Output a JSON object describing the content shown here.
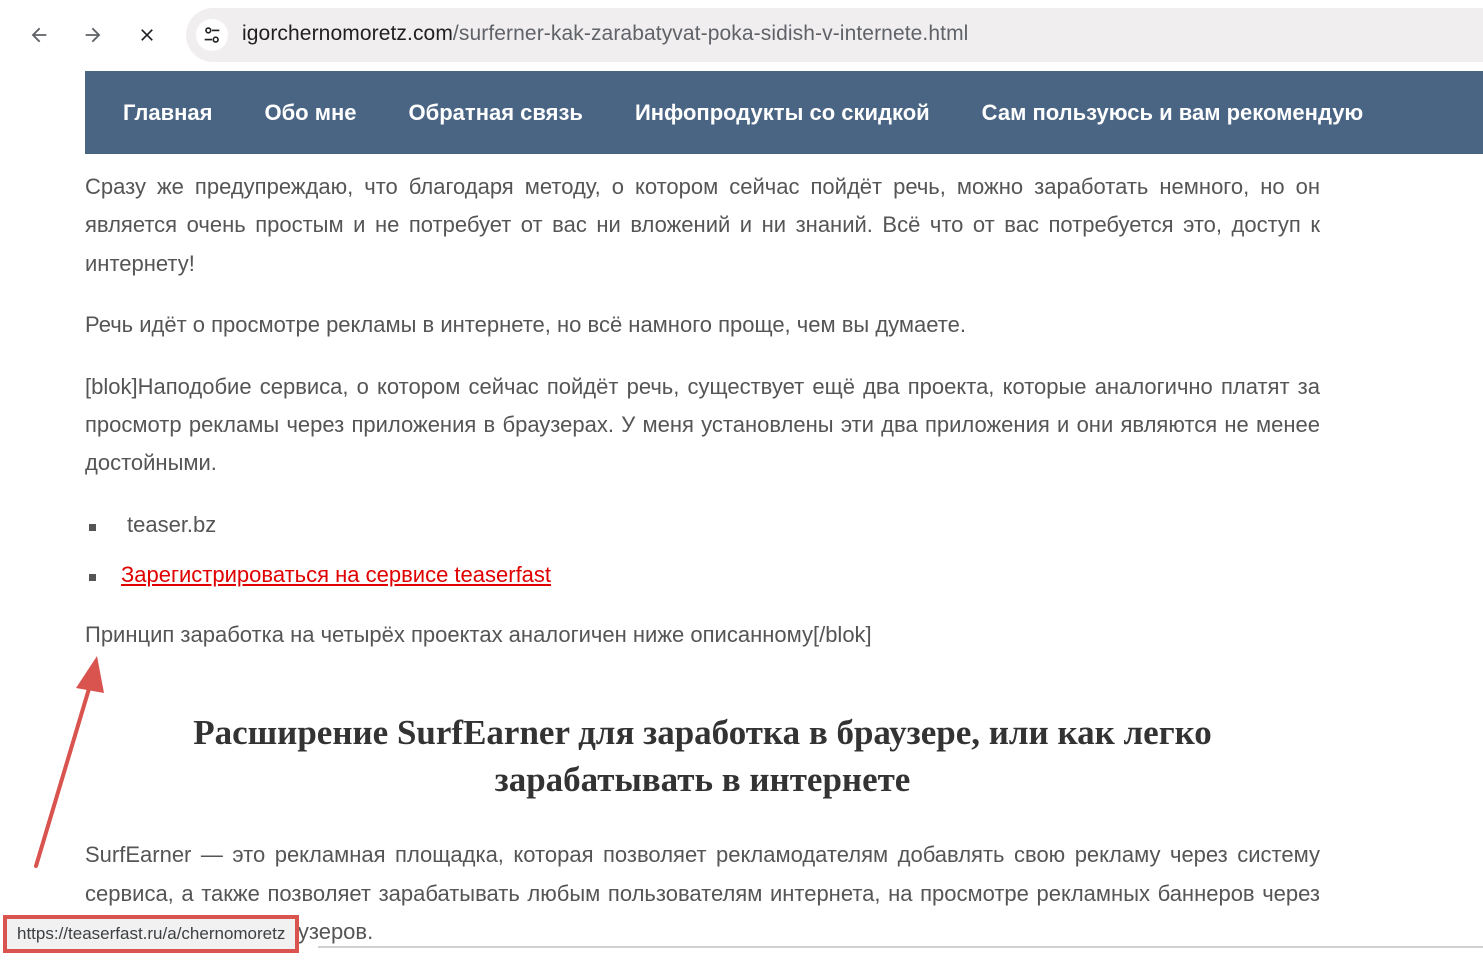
{
  "browser": {
    "url_host": "igorchernomoretz.com",
    "url_path": "/surferner-kak-zarabatyvat-poka-sidish-v-internete.html",
    "back_icon": "arrow-left-icon",
    "forward_icon": "arrow-right-icon",
    "stop_icon": "close-icon",
    "site_info_icon": "tune-icon"
  },
  "site_nav": {
    "items": [
      {
        "label": "Главная"
      },
      {
        "label": "Обо мне"
      },
      {
        "label": "Обратная связь"
      },
      {
        "label": "Инфопродукты со скидкой"
      },
      {
        "label": "Сам пользуюсь и вам рекомендую"
      }
    ]
  },
  "article": {
    "paragraph_1": "Сразу же предупреждаю, что благодаря методу, о котором сейчас пойдёт речь, можно заработать немного, но он является очень простым и не потребует от вас ни вложений и ни знаний. Всё что от вас потребуется это, доступ к интернету!",
    "paragraph_2": "Речь идёт о просмотре рекламы в интернете, но всё намного проще, чем вы думаете.",
    "paragraph_3": "[blok]Наподобие сервиса, о котором сейчас пойдёт речь, существует ещё два проекта, которые аналогично платят за просмотр рекламы через приложения в браузерах. У меня установлены эти два приложения и они являются не менее достойными.",
    "list": [
      {
        "text": "teaser.bz",
        "is_link": false
      },
      {
        "text": "Зарегистрироваться на сервисе teaserfast",
        "is_link": true
      }
    ],
    "paragraph_4": "Принцип заработка на четырёх проектах аналогичен ниже описанному[/blok]",
    "heading": "Расширение SurfEarner для заработка в браузере, или как легко зарабатывать в интернете",
    "paragraph_5": "SurfEarner — это рекламная площадка, которая позволяет рекламодателям добавлять свою рекламу через систему сервиса, а также позволяет зарабатывать любым пользователям интернета, на просмотре рекламных баннеров через расширения для браузеров."
  },
  "status_bar": {
    "url": "https://teaserfast.ru/a/chernomoretz"
  },
  "colors": {
    "nav_bg": "#4a6584",
    "link": "#e00000",
    "annotation": "#d9534f"
  }
}
